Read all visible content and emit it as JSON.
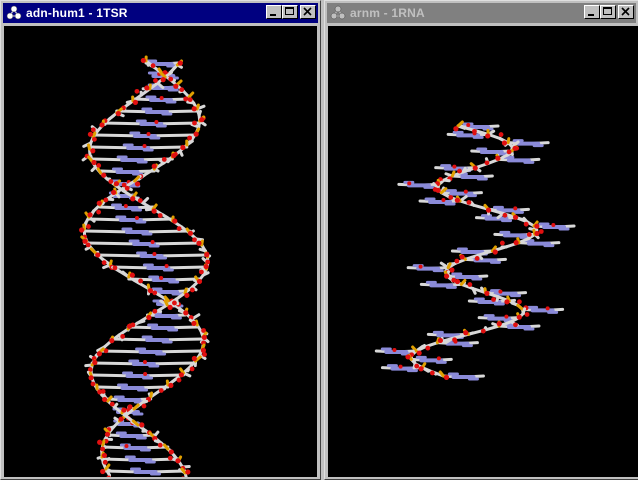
{
  "windows": [
    {
      "title": "adn-hum1 - 1TSR",
      "state": "active",
      "icon": "molecule-icon",
      "content": "dna-double-helix-stick-model"
    },
    {
      "title": "arnm - 1RNA",
      "state": "inactive",
      "icon": "molecule-icon",
      "content": "rna-helix-stick-model"
    }
  ],
  "window_controls": [
    "minimize-icon",
    "maximize-icon",
    "close-icon"
  ],
  "colors": {
    "title_active": "#000080",
    "title_inactive": "#808080",
    "viewport_bg": "#000000",
    "carbon": "#d8d8d8",
    "nitrogen": "#8a8ad8",
    "oxygen": "#e01010",
    "phosphorus": "#e0a000"
  }
}
